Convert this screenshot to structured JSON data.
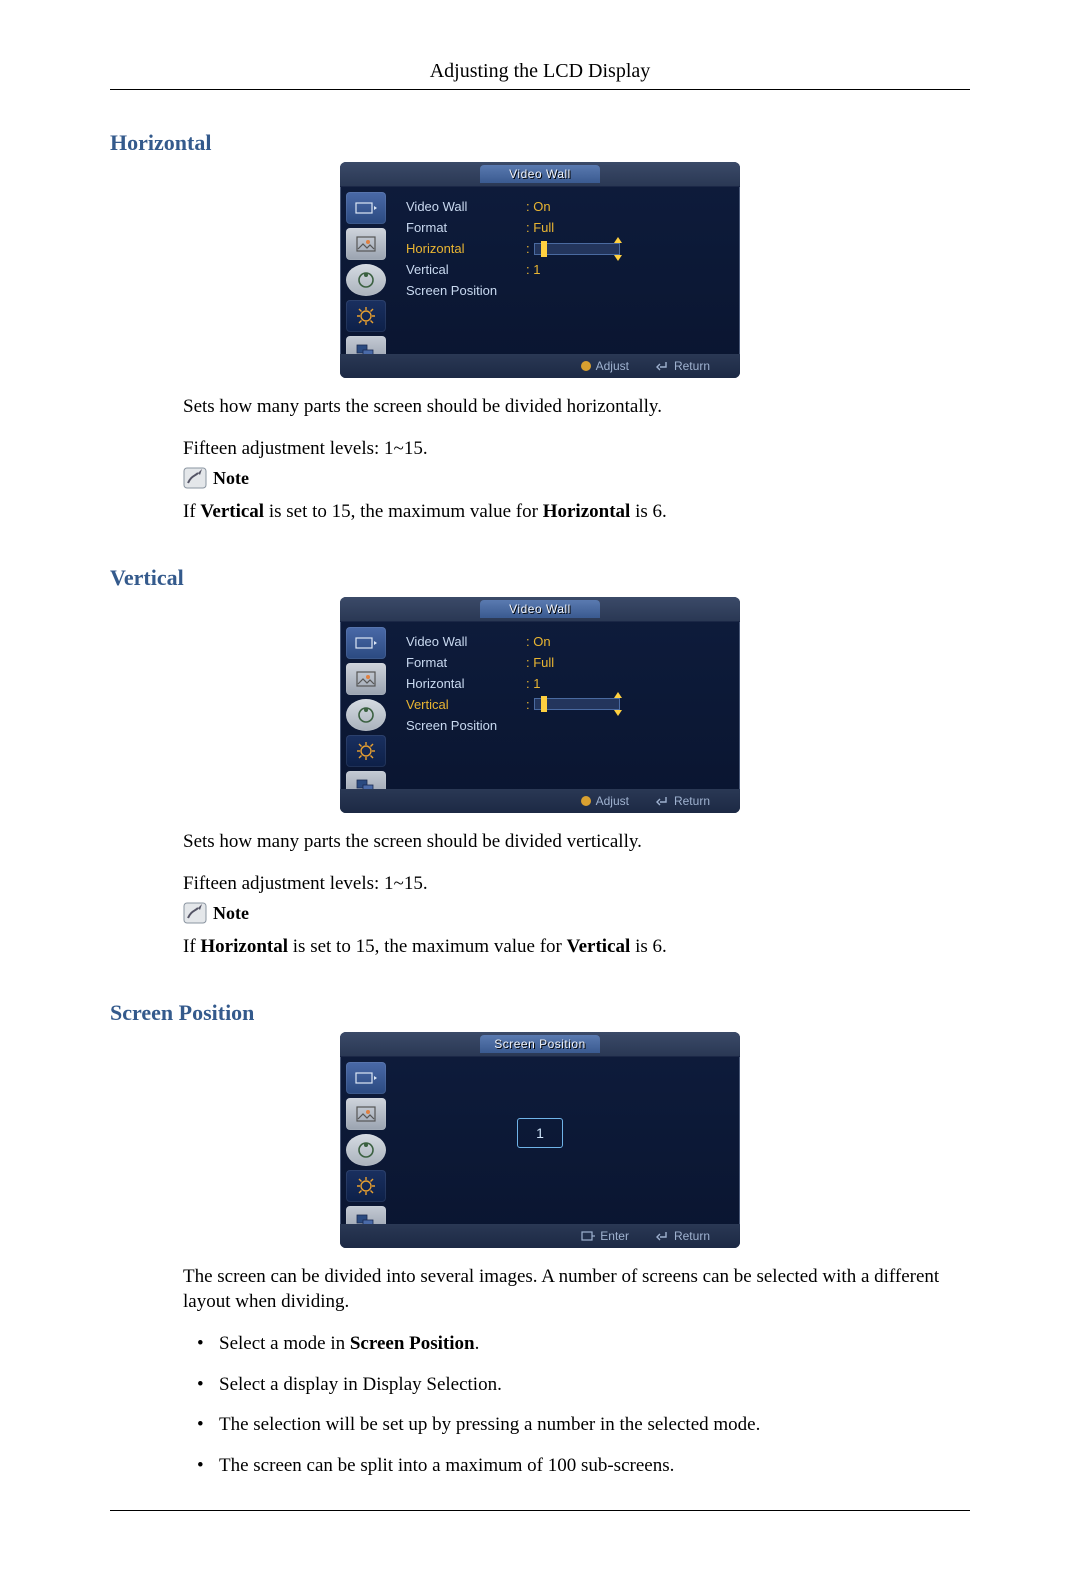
{
  "header": {
    "title": "Adjusting the LCD Display"
  },
  "sections": {
    "horizontal": {
      "heading": "Horizontal",
      "osd": {
        "tab_title": "Video Wall",
        "items": [
          "Video Wall",
          "Format",
          "Horizontal",
          "Vertical",
          "Screen Position"
        ],
        "values": {
          "video_wall": ": On",
          "format": ": Full",
          "horizontal": ":",
          "vertical": ": 1"
        },
        "highlight_index": 2,
        "footer": {
          "left": "Adjust",
          "right": "Return"
        }
      },
      "p1": "Sets how many parts the screen should be divided horizontally.",
      "p2": "Fifteen adjustment levels: 1~15.",
      "note_label": "Note",
      "note_before": "If ",
      "note_b1": "Vertical",
      "note_mid": " is set to 15, the maximum value for ",
      "note_b2": "Horizontal",
      "note_after": " is 6."
    },
    "vertical": {
      "heading": "Vertical",
      "osd": {
        "tab_title": "Video Wall",
        "items": [
          "Video Wall",
          "Format",
          "Horizontal",
          "Vertical",
          "Screen Position"
        ],
        "values": {
          "video_wall": ": On",
          "format": ": Full",
          "horizontal": ": 1",
          "vertical": ":"
        },
        "highlight_index": 3,
        "footer": {
          "left": "Adjust",
          "right": "Return"
        }
      },
      "p1": "Sets how many parts the screen should be divided vertically.",
      "p2": "Fifteen adjustment levels: 1~15.",
      "note_label": "Note",
      "note_before": "If ",
      "note_b1": "Horizontal",
      "note_mid": " is set to 15, the maximum value for ",
      "note_b2": "Vertical",
      "note_after": " is 6."
    },
    "screen_position": {
      "heading": "Screen Position",
      "osd": {
        "tab_title": "Screen Position",
        "value": "1",
        "footer": {
          "left": "Enter",
          "right": "Return"
        }
      },
      "p1": "The screen can be divided into several images. A number of screens can be selected with a different layout when dividing.",
      "bullets": {
        "b1_pre": "Select a mode in ",
        "b1_b": "Screen Position",
        "b1_post": ".",
        "b2": "Select a display in Display Selection.",
        "b3": "The selection will be set up by pressing a number in the selected mode.",
        "b4": "The screen can be split into a maximum of 100 sub-screens."
      }
    }
  }
}
